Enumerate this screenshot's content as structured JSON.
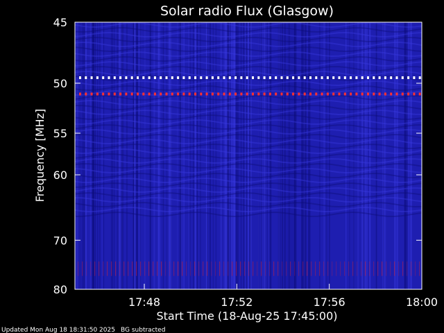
{
  "chart_data": {
    "type": "heatmap",
    "title": "Solar radio Flux (Glasgow)",
    "xlabel": "Start Time (18-Aug-25 17:45:00)",
    "ylabel": "Frequency [MHz]",
    "x_range": [
      "17:45:00",
      "18:00:00"
    ],
    "y_range_mhz": [
      45,
      80
    ],
    "x_ticks": [
      "17:48",
      "17:52",
      "17:56",
      "18:00"
    ],
    "y_ticks": [
      45,
      50,
      55,
      60,
      70,
      80
    ],
    "y_tick_labels": [
      "45",
      "50",
      "55",
      "60",
      "70",
      "80"
    ],
    "colors": {
      "background": "#000000",
      "plot_base": "#1e1eb0",
      "plot_dark": "#0c0c78",
      "plot_light": "#3a3ae0",
      "band": "#c02040",
      "hot": "#ffffff",
      "warm": "#ffb060"
    },
    "features": [
      {
        "name": "interference-line",
        "frequency_mhz": 49.5,
        "color": "#ffffff"
      },
      {
        "name": "interference-line",
        "frequency_mhz": 51.0,
        "color": "#ff3030"
      },
      {
        "name": "interference-band",
        "frequency_mhz_range": [
          74,
          77
        ],
        "color": "#c02040"
      }
    ]
  },
  "footer": {
    "updated": "Updated Mon Aug 18 18:31:50 2025",
    "note": "BG subtracted"
  }
}
